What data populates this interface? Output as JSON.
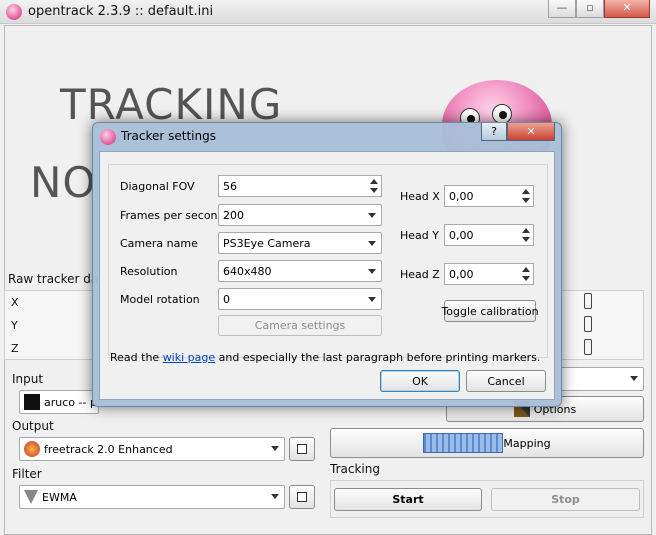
{
  "main_window": {
    "title": "opentrack 2.3.9 :: default.ini",
    "minimize": "—",
    "maximize": "▫",
    "close": "✕",
    "tracking_text": "TRACKING",
    "not_text": "NO",
    "raw_tracker_label": "Raw tracker data",
    "axes": [
      "X",
      "Y",
      "Z"
    ],
    "input_label": "Input",
    "input_value": "aruco -- p",
    "output_label": "Output",
    "output_value": "freetrack 2.0 Enhanced",
    "filter_label": "Filter",
    "filter_value": "EWMA",
    "options_label": "Options",
    "mapping_label": "Mapping",
    "tracking_label": "Tracking",
    "start_label": "Start",
    "stop_label": "Stop"
  },
  "dialog": {
    "title": "Tracker settings",
    "help_btn": "?",
    "close_btn": "✕",
    "fields": {
      "diagonal_fov_label": "Diagonal FOV",
      "diagonal_fov_value": "56",
      "fps_label": "Frames per second",
      "fps_value": "200",
      "camera_name_label": "Camera name",
      "camera_name_value": "PS3Eye Camera",
      "resolution_label": "Resolution",
      "resolution_value": "640x480",
      "model_rotation_label": "Model rotation",
      "model_rotation_value": "0",
      "camera_settings_btn": "Camera settings",
      "head_x_label": "Head X",
      "head_x_value": "0,00",
      "head_y_label": "Head Y",
      "head_y_value": "0,00",
      "head_z_label": "Head Z",
      "head_z_value": "0,00",
      "toggle_calibration_btn": "Toggle calibration"
    },
    "info_prefix": "Read the ",
    "info_link": "wiki page",
    "info_suffix": " and especially the last paragraph before printing markers.",
    "ok_btn": "OK",
    "cancel_btn": "Cancel"
  }
}
